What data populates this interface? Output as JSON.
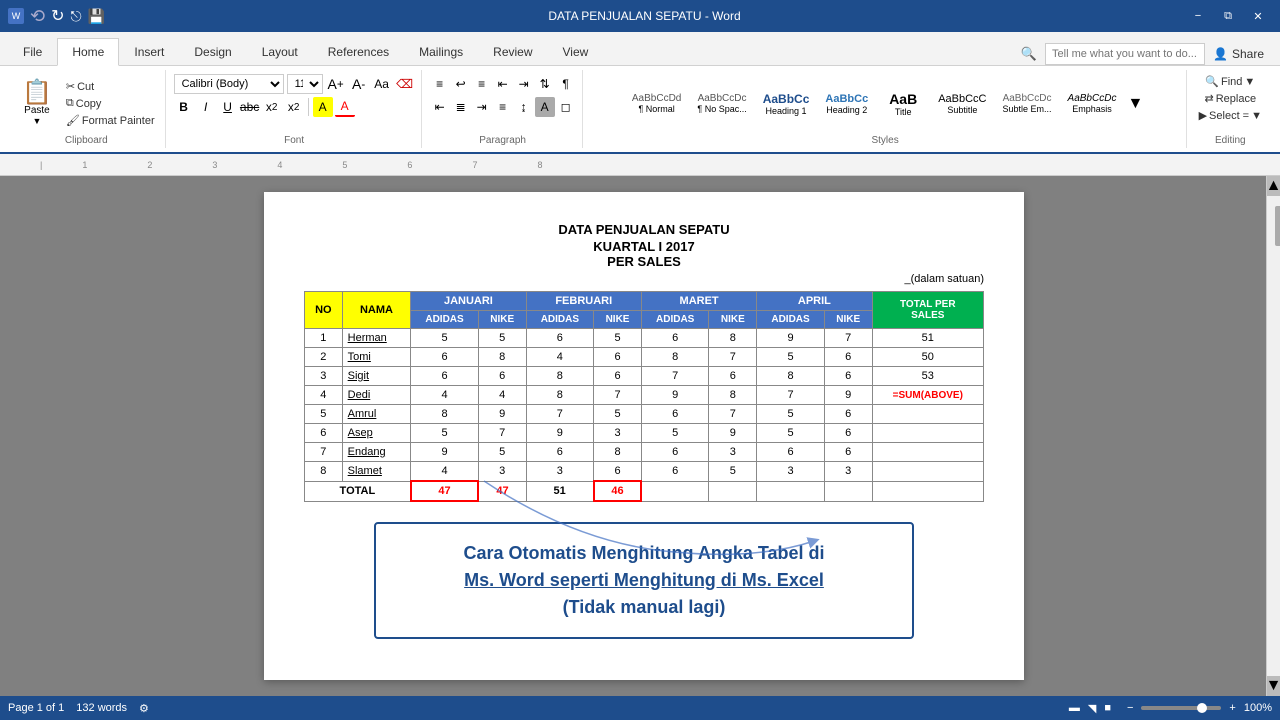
{
  "titlebar": {
    "title": "DATA PENJUALAN SEPATU - Word",
    "buttons": [
      "minimize",
      "restore",
      "close"
    ]
  },
  "ribbon": {
    "tabs": [
      "File",
      "Home",
      "Insert",
      "Design",
      "Layout",
      "References",
      "Mailings",
      "Review",
      "View"
    ],
    "active_tab": "Home",
    "search_placeholder": "Tell me what you want to do...",
    "share_label": "Share",
    "groups": {
      "clipboard": {
        "label": "Clipboard",
        "paste": "Paste",
        "cut": "Cut",
        "copy": "Copy",
        "format_painter": "Format Painter"
      },
      "font": {
        "label": "Font",
        "font_name": "Calibri (Body)",
        "font_size": "11",
        "bold": "B",
        "italic": "I",
        "underline": "U",
        "strikethrough": "abc",
        "subscript": "x₂",
        "superscript": "x²",
        "highlight": "A",
        "font_color": "A"
      },
      "paragraph": {
        "label": "Paragraph"
      },
      "styles": {
        "label": "Styles",
        "items": [
          {
            "label": "¶ Normal",
            "class": "style-normal"
          },
          {
            "label": "¶ No Spac...",
            "class": "style-no-spacing"
          },
          {
            "label": "Heading 1",
            "class": "style-h1"
          },
          {
            "label": "Heading 2",
            "class": "style-h2"
          },
          {
            "label": "Title",
            "class": "style-title-s"
          },
          {
            "label": "Subtitle",
            "class": "style-subtitle-s"
          },
          {
            "label": "Subtle Em...",
            "class": "style-subtle"
          },
          {
            "label": "Emphasis",
            "class": "style-emphasis"
          },
          {
            "label": "AaBbCcDc",
            "class": "style-normal"
          }
        ]
      },
      "editing": {
        "label": "Editing",
        "find": "Find",
        "replace": "Replace",
        "select": "Select ="
      }
    }
  },
  "document": {
    "title_line1": "DATA PENJUALAN SEPATU",
    "title_line2": "KUARTAL I 2017",
    "title_line3": "PER SALES",
    "note": "_(dalam satuan)",
    "table": {
      "headers_row1": [
        "NO",
        "NAMA",
        "JANUARI",
        "",
        "FEBRUARI",
        "",
        "MARET",
        "",
        "APRIL",
        "",
        "TOTAL PER SALES"
      ],
      "headers_row2": [
        "",
        "",
        "ADIDAS",
        "NIKE",
        "ADIDAS",
        "NIKE",
        "ADIDAS",
        "NIKE",
        "ADIDAS",
        "NIKE",
        ""
      ],
      "rows": [
        {
          "no": "1",
          "nama": "Herman",
          "jan_adidas": "5",
          "jan_nike": "5",
          "feb_adidas": "6",
          "feb_nike": "5",
          "mar_adidas": "6",
          "mar_nike": "8",
          "apr_adidas": "9",
          "apr_nike": "7",
          "total": "51"
        },
        {
          "no": "2",
          "nama": "Tomi",
          "jan_adidas": "6",
          "jan_nike": "8",
          "feb_adidas": "4",
          "feb_nike": "6",
          "mar_adidas": "8",
          "mar_nike": "7",
          "apr_adidas": "5",
          "apr_nike": "6",
          "total": "50"
        },
        {
          "no": "3",
          "nama": "Sigit",
          "jan_adidas": "6",
          "jan_nike": "6",
          "feb_adidas": "8",
          "feb_nike": "6",
          "mar_adidas": "7",
          "mar_nike": "6",
          "apr_adidas": "8",
          "apr_nike": "6",
          "total": "53"
        },
        {
          "no": "4",
          "nama": "Dedi",
          "jan_adidas": "4",
          "jan_nike": "4",
          "feb_adidas": "8",
          "feb_nike": "7",
          "mar_adidas": "9",
          "mar_nike": "8",
          "apr_adidas": "7",
          "apr_nike": "9",
          "total": "=SUM(ABOVE)"
        },
        {
          "no": "5",
          "nama": "Amrul",
          "jan_adidas": "8",
          "jan_nike": "9",
          "feb_adidas": "7",
          "feb_nike": "5",
          "mar_adidas": "6",
          "mar_nike": "7",
          "apr_adidas": "5",
          "apr_nike": "6",
          "total": ""
        },
        {
          "no": "6",
          "nama": "Asep",
          "jan_adidas": "5",
          "jan_nike": "7",
          "feb_adidas": "9",
          "feb_nike": "3",
          "mar_adidas": "5",
          "mar_nike": "9",
          "apr_adidas": "5",
          "apr_nike": "6",
          "total": ""
        },
        {
          "no": "7",
          "nama": "Endang",
          "jan_adidas": "9",
          "jan_nike": "5",
          "feb_adidas": "6",
          "feb_nike": "8",
          "mar_adidas": "6",
          "mar_nike": "3",
          "apr_adidas": "6",
          "apr_nike": "6",
          "total": ""
        },
        {
          "no": "8",
          "nama": "Slamet",
          "jan_adidas": "4",
          "jan_nike": "3",
          "feb_adidas": "3",
          "feb_nike": "6",
          "mar_adidas": "6",
          "mar_nike": "5",
          "apr_adidas": "3",
          "apr_nike": "3",
          "total": ""
        }
      ],
      "total_row": {
        "label": "TOTAL",
        "jan_adidas": "47",
        "jan_nike": "47",
        "feb_adidas": "51",
        "feb_nike": "46",
        "mar_adidas": "",
        "mar_nike": "",
        "apr_adidas": "",
        "apr_nike": "",
        "total": ""
      }
    },
    "caption": {
      "line1": "Cara Otomatis Menghitung Angka Tabel di",
      "line2": "Ms. Word seperti Menghitung di Ms. Excel",
      "line3": "(Tidak manual lagi)"
    }
  },
  "statusbar": {
    "page": "Page 1 of 1",
    "words": "132 words",
    "zoom": "100%"
  }
}
